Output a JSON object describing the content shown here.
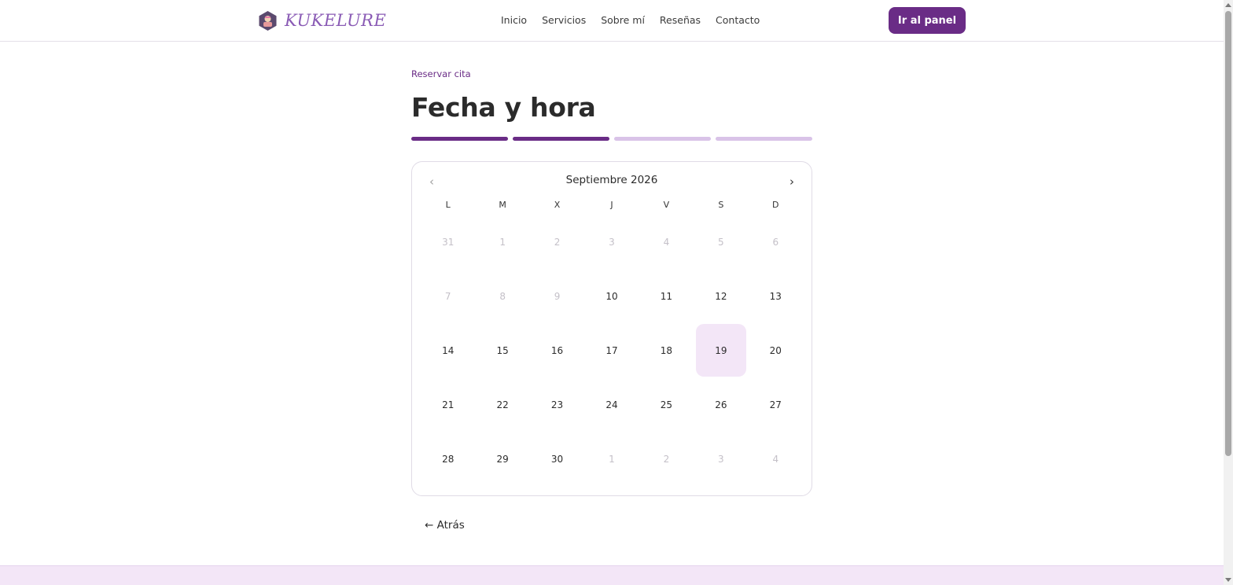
{
  "header": {
    "logo_text": "KUKELURE",
    "nav": [
      "Inicio",
      "Servicios",
      "Sobre mí",
      "Reseñas",
      "Contacto"
    ],
    "panel_button": "Ir al panel"
  },
  "breadcrumb": "Reservar cita",
  "title": "Fecha y hora",
  "steps": {
    "total": 4,
    "completed": 2
  },
  "calendar": {
    "month_label": "Septiembre 2026",
    "prev_icon": "‹",
    "next_icon": "›",
    "weekdays": [
      "L",
      "M",
      "X",
      "J",
      "V",
      "S",
      "D"
    ],
    "weeks": [
      [
        {
          "d": "31",
          "muted": true
        },
        {
          "d": "1",
          "muted": true
        },
        {
          "d": "2",
          "muted": true
        },
        {
          "d": "3",
          "muted": true
        },
        {
          "d": "4",
          "muted": true
        },
        {
          "d": "5",
          "muted": true
        },
        {
          "d": "6",
          "muted": true
        }
      ],
      [
        {
          "d": "7",
          "muted": true
        },
        {
          "d": "8",
          "muted": true
        },
        {
          "d": "9",
          "muted": true
        },
        {
          "d": "10"
        },
        {
          "d": "11"
        },
        {
          "d": "12"
        },
        {
          "d": "13"
        }
      ],
      [
        {
          "d": "14"
        },
        {
          "d": "15"
        },
        {
          "d": "16"
        },
        {
          "d": "17"
        },
        {
          "d": "18"
        },
        {
          "d": "19",
          "selected": true
        },
        {
          "d": "20"
        }
      ],
      [
        {
          "d": "21"
        },
        {
          "d": "22"
        },
        {
          "d": "23"
        },
        {
          "d": "24"
        },
        {
          "d": "25"
        },
        {
          "d": "26"
        },
        {
          "d": "27"
        }
      ],
      [
        {
          "d": "28"
        },
        {
          "d": "29"
        },
        {
          "d": "30"
        },
        {
          "d": "1",
          "muted": true
        },
        {
          "d": "2",
          "muted": true
        },
        {
          "d": "3",
          "muted": true
        },
        {
          "d": "4",
          "muted": true
        }
      ]
    ]
  },
  "back_button": "← Atrás",
  "colors": {
    "brand": "#6a2c86",
    "brand_light": "#d9c3e8",
    "selected_bg": "#f3e6f7"
  }
}
